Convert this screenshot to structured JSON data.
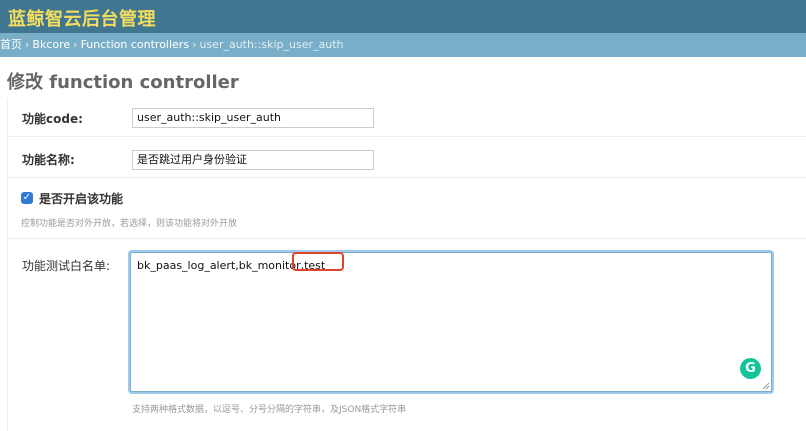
{
  "header": {
    "title": "蓝鲸智云后台管理"
  },
  "breadcrumbs": {
    "home": "首页",
    "app": "Bkcore",
    "model": "Function controllers",
    "current": "user_auth::skip_user_auth",
    "separator": "›"
  },
  "page": {
    "title": "修改 function controller"
  },
  "form": {
    "func_code": {
      "label": "功能code:",
      "value": "user_auth::skip_user_auth"
    },
    "func_name": {
      "label": "功能名称:",
      "value": "是否跳过用户身份验证"
    },
    "switch": {
      "label": "是否开启该功能",
      "checked": true,
      "help": "控制功能是否对外开放，若选择，则该功能将对外开放"
    },
    "whitelist": {
      "label": "功能测试白名单:",
      "value": "bk_paas_log_alert,bk_monitor,test",
      "help": "支持两种格式数据，以逗号、分号分隔的字符串，及JSON格式字符串"
    }
  },
  "icons": {
    "checkbox_check": "✓",
    "grammarly": "G"
  },
  "colors": {
    "header_bg": "#417690",
    "title_text": "#f5dd5d",
    "breadcrumb_bg": "#79aec8",
    "checkbox": "#2f7bd6",
    "highlight": "#e0452b",
    "grammarly": "#15c39a"
  }
}
